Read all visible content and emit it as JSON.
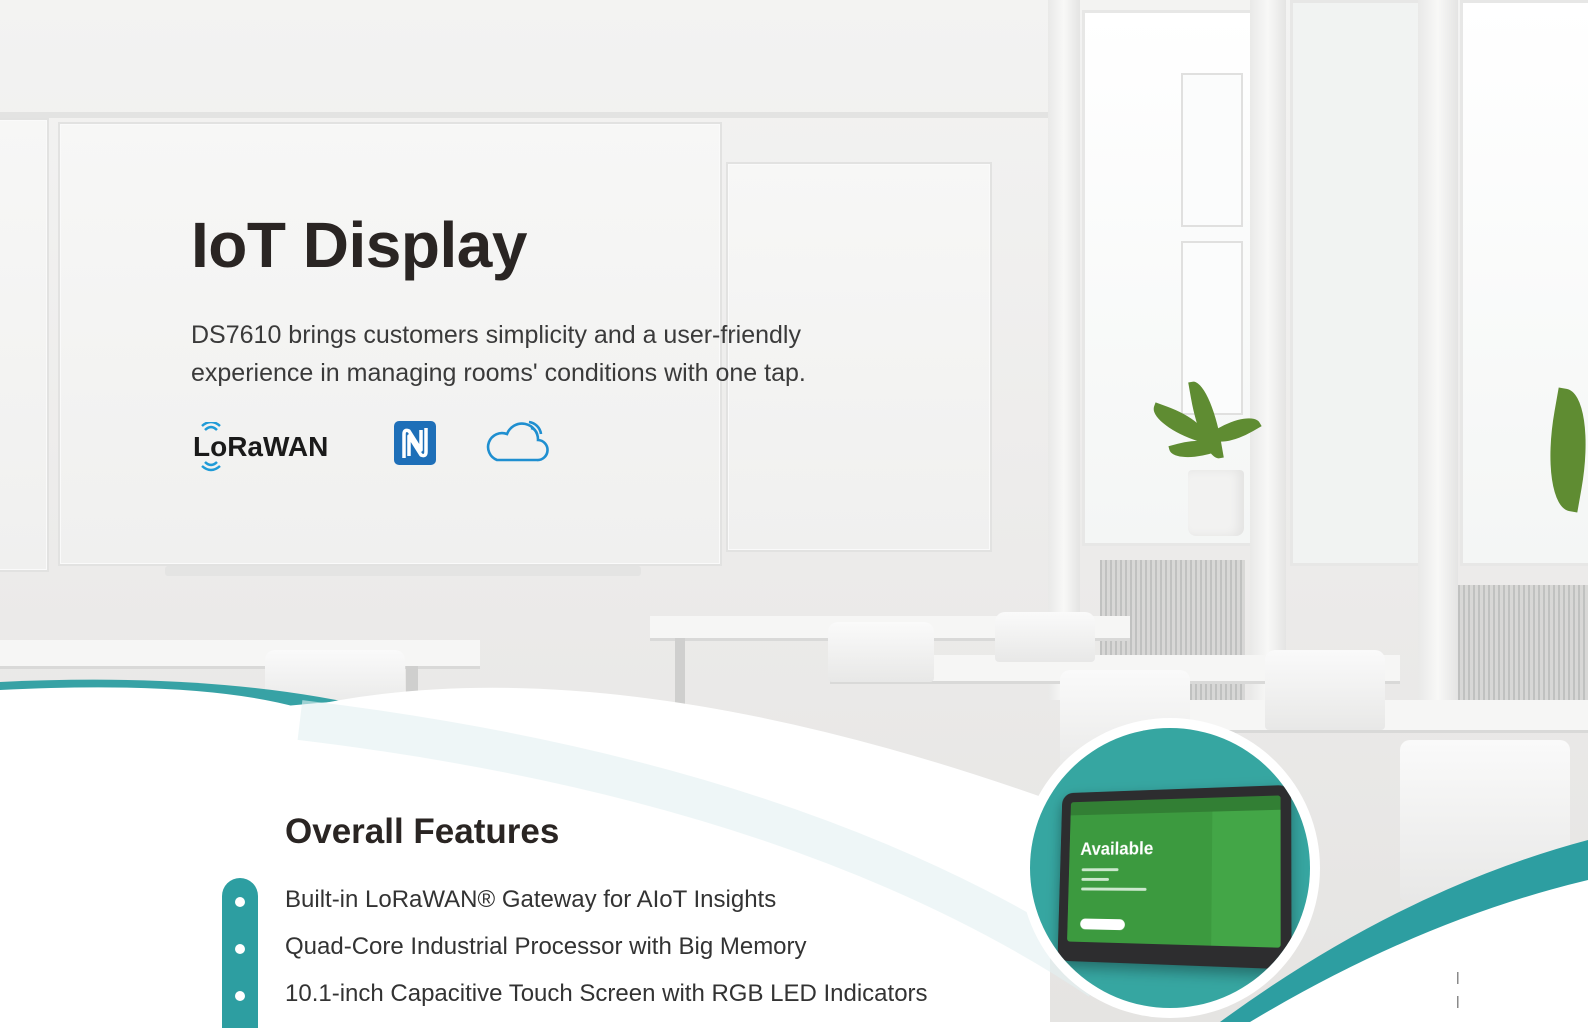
{
  "hero": {
    "title": "IoT Display",
    "description": "DS7610 brings customers simplicity and a user-friendly experience in managing rooms' conditions with one tap."
  },
  "tech_icons": [
    {
      "name": "lorawan-logo",
      "label": "LoRaWAN"
    },
    {
      "name": "nfc-icon"
    },
    {
      "name": "cloud-icon"
    }
  ],
  "colors": {
    "accent_teal": "#2d9ea1",
    "lorawan_blue": "#1f9bd7",
    "nfc_blue": "#1e6fb8",
    "screen_green": "#3c9a3f"
  },
  "features": {
    "title": "Overall Features",
    "items": [
      "Built-in LoRaWAN® Gateway for AIoT Insights",
      "Quad-Core Industrial Processor with Big Memory",
      "10.1-inch Capacitive Touch Screen with RGB LED Indicators"
    ]
  },
  "device": {
    "status_text": "Available"
  }
}
